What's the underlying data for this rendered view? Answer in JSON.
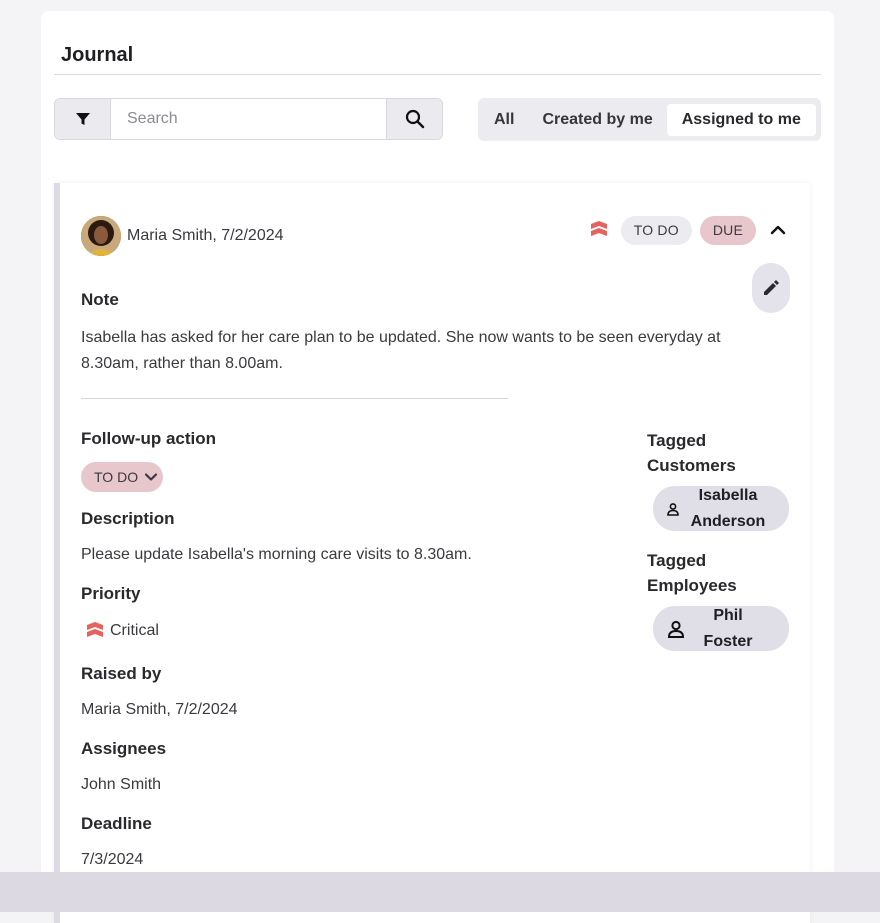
{
  "journal": {
    "title": "Journal"
  },
  "search": {
    "placeholder": "Search",
    "value": ""
  },
  "filters": {
    "all": "All",
    "created_by_me": "Created by me",
    "assigned_to_me": "Assigned to me",
    "active": "Assigned to me"
  },
  "entry": {
    "author": "Maria Smith, 7/2/2024",
    "status_todo": "TO DO",
    "status_due": "DUE",
    "note_label": "Note",
    "note_text_line1": "Isabella has asked for her care plan to be updated. She now wants to be seen everyday at",
    "note_text_line2": "8.30am, rather than 8.00am.",
    "followup_label": "Follow-up action",
    "followup_value": "TO DO",
    "description_label": "Description",
    "description_text": "Please update Isabella's morning care visits to 8.30am.",
    "priority_label": "Priority",
    "priority_value": "Critical",
    "raised_by_label": "Raised by",
    "raised_by_value": "Maria Smith, 7/2/2024",
    "assignees_label": "Assignees",
    "assignees_value": "John Smith",
    "deadline_label": "Deadline",
    "deadline_value": "7/3/2024",
    "tagged_customers_label_1": "Tagged",
    "tagged_customers_label_2": "Customers",
    "customer_first": "Isabella",
    "customer_last": "Anderson",
    "tagged_employees_label_1": "Tagged",
    "tagged_employees_label_2": "Employees",
    "employee_first": "Phil",
    "employee_last": "Foster"
  },
  "colors": {
    "critical": "#e5625e",
    "due_pill": "#e8c7cc",
    "chip": "#e0dee6"
  }
}
